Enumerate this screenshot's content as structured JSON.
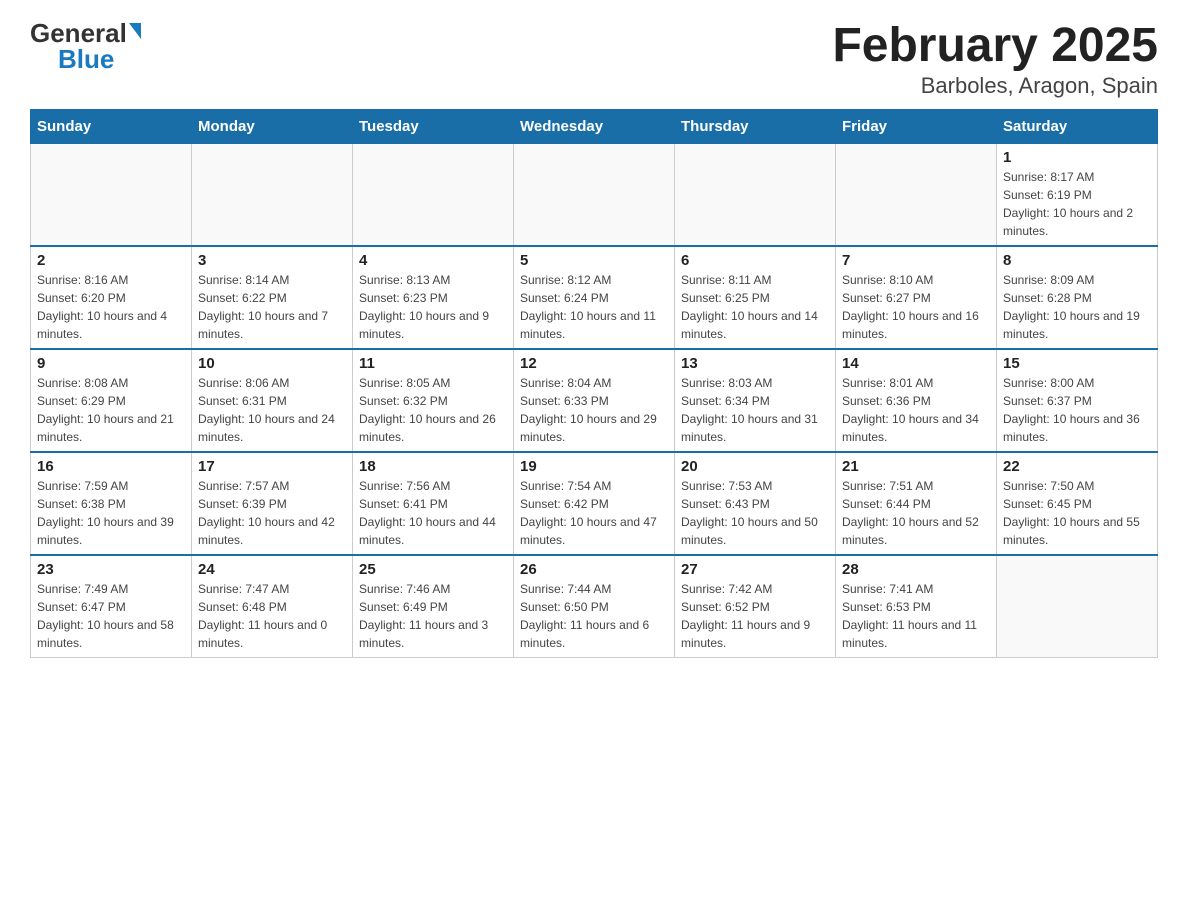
{
  "header": {
    "logo_general": "General",
    "logo_blue": "Blue",
    "title": "February 2025",
    "subtitle": "Barboles, Aragon, Spain"
  },
  "days_of_week": [
    "Sunday",
    "Monday",
    "Tuesday",
    "Wednesday",
    "Thursday",
    "Friday",
    "Saturday"
  ],
  "weeks": [
    [
      {
        "day": "",
        "info": ""
      },
      {
        "day": "",
        "info": ""
      },
      {
        "day": "",
        "info": ""
      },
      {
        "day": "",
        "info": ""
      },
      {
        "day": "",
        "info": ""
      },
      {
        "day": "",
        "info": ""
      },
      {
        "day": "1",
        "info": "Sunrise: 8:17 AM\nSunset: 6:19 PM\nDaylight: 10 hours and 2 minutes."
      }
    ],
    [
      {
        "day": "2",
        "info": "Sunrise: 8:16 AM\nSunset: 6:20 PM\nDaylight: 10 hours and 4 minutes."
      },
      {
        "day": "3",
        "info": "Sunrise: 8:14 AM\nSunset: 6:22 PM\nDaylight: 10 hours and 7 minutes."
      },
      {
        "day": "4",
        "info": "Sunrise: 8:13 AM\nSunset: 6:23 PM\nDaylight: 10 hours and 9 minutes."
      },
      {
        "day": "5",
        "info": "Sunrise: 8:12 AM\nSunset: 6:24 PM\nDaylight: 10 hours and 11 minutes."
      },
      {
        "day": "6",
        "info": "Sunrise: 8:11 AM\nSunset: 6:25 PM\nDaylight: 10 hours and 14 minutes."
      },
      {
        "day": "7",
        "info": "Sunrise: 8:10 AM\nSunset: 6:27 PM\nDaylight: 10 hours and 16 minutes."
      },
      {
        "day": "8",
        "info": "Sunrise: 8:09 AM\nSunset: 6:28 PM\nDaylight: 10 hours and 19 minutes."
      }
    ],
    [
      {
        "day": "9",
        "info": "Sunrise: 8:08 AM\nSunset: 6:29 PM\nDaylight: 10 hours and 21 minutes."
      },
      {
        "day": "10",
        "info": "Sunrise: 8:06 AM\nSunset: 6:31 PM\nDaylight: 10 hours and 24 minutes."
      },
      {
        "day": "11",
        "info": "Sunrise: 8:05 AM\nSunset: 6:32 PM\nDaylight: 10 hours and 26 minutes."
      },
      {
        "day": "12",
        "info": "Sunrise: 8:04 AM\nSunset: 6:33 PM\nDaylight: 10 hours and 29 minutes."
      },
      {
        "day": "13",
        "info": "Sunrise: 8:03 AM\nSunset: 6:34 PM\nDaylight: 10 hours and 31 minutes."
      },
      {
        "day": "14",
        "info": "Sunrise: 8:01 AM\nSunset: 6:36 PM\nDaylight: 10 hours and 34 minutes."
      },
      {
        "day": "15",
        "info": "Sunrise: 8:00 AM\nSunset: 6:37 PM\nDaylight: 10 hours and 36 minutes."
      }
    ],
    [
      {
        "day": "16",
        "info": "Sunrise: 7:59 AM\nSunset: 6:38 PM\nDaylight: 10 hours and 39 minutes."
      },
      {
        "day": "17",
        "info": "Sunrise: 7:57 AM\nSunset: 6:39 PM\nDaylight: 10 hours and 42 minutes."
      },
      {
        "day": "18",
        "info": "Sunrise: 7:56 AM\nSunset: 6:41 PM\nDaylight: 10 hours and 44 minutes."
      },
      {
        "day": "19",
        "info": "Sunrise: 7:54 AM\nSunset: 6:42 PM\nDaylight: 10 hours and 47 minutes."
      },
      {
        "day": "20",
        "info": "Sunrise: 7:53 AM\nSunset: 6:43 PM\nDaylight: 10 hours and 50 minutes."
      },
      {
        "day": "21",
        "info": "Sunrise: 7:51 AM\nSunset: 6:44 PM\nDaylight: 10 hours and 52 minutes."
      },
      {
        "day": "22",
        "info": "Sunrise: 7:50 AM\nSunset: 6:45 PM\nDaylight: 10 hours and 55 minutes."
      }
    ],
    [
      {
        "day": "23",
        "info": "Sunrise: 7:49 AM\nSunset: 6:47 PM\nDaylight: 10 hours and 58 minutes."
      },
      {
        "day": "24",
        "info": "Sunrise: 7:47 AM\nSunset: 6:48 PM\nDaylight: 11 hours and 0 minutes."
      },
      {
        "day": "25",
        "info": "Sunrise: 7:46 AM\nSunset: 6:49 PM\nDaylight: 11 hours and 3 minutes."
      },
      {
        "day": "26",
        "info": "Sunrise: 7:44 AM\nSunset: 6:50 PM\nDaylight: 11 hours and 6 minutes."
      },
      {
        "day": "27",
        "info": "Sunrise: 7:42 AM\nSunset: 6:52 PM\nDaylight: 11 hours and 9 minutes."
      },
      {
        "day": "28",
        "info": "Sunrise: 7:41 AM\nSunset: 6:53 PM\nDaylight: 11 hours and 11 minutes."
      },
      {
        "day": "",
        "info": ""
      }
    ]
  ]
}
